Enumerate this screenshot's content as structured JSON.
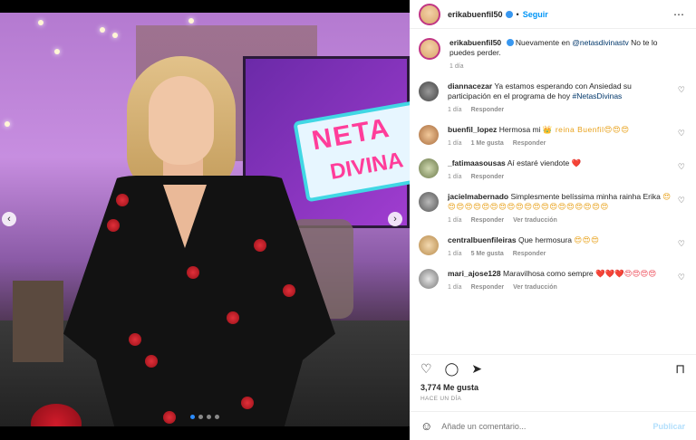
{
  "header": {
    "username": "erikabuenfil50",
    "follow_label": "Seguir",
    "separator": "•",
    "more_icon": "⋯"
  },
  "caption": {
    "username": "erikabuenfil50",
    "text_pre": "Nuevamente en ",
    "mention": "@netasdivinastv",
    "text_post": " No te lo puedes perder.",
    "time": "1 día"
  },
  "comments": [
    {
      "username": "diannacezar",
      "text": "Ya estamos esperando con Ansiedad su participación en el programa de hoy ",
      "hashtag": "#NetasDivinas",
      "time": "1 día",
      "likes": "",
      "reply": "Responder",
      "translate": ""
    },
    {
      "username": "buenfil_lopez",
      "text": "Hermosa mi ",
      "emoji": "👑 reina Buenfil😍😍😍",
      "time": "1 día",
      "likes": "1 Me gusta",
      "reply": "Responder",
      "translate": ""
    },
    {
      "username": "_fatimaasousas",
      "text": "Aí estaré viendote ",
      "emoji": "❤️",
      "time": "1 día",
      "likes": "",
      "reply": "Responder",
      "translate": ""
    },
    {
      "username": "jacielmabernado",
      "text": "Simplesmente belíssima minha rainha Erika ",
      "emoji": "😍😍😍😍😍😍😍😍😍😍😍😍😍😍😍😍😍😍😍😍",
      "time": "1 día",
      "likes": "",
      "reply": "Responder",
      "translate": "Ver traducción"
    },
    {
      "username": "centralbuenfileiras",
      "text": "Que hermosura ",
      "emoji": "😍😍😍",
      "time": "1 día",
      "likes": "5 Me gusta",
      "reply": "Responder",
      "translate": ""
    },
    {
      "username": "mari_ajose128",
      "text": "Maravilhosa como sempre ",
      "emoji": "❤️❤️❤️😍😍😍😍",
      "time": "1 día",
      "likes": "",
      "reply": "Responder",
      "translate": "Ver traducción"
    }
  ],
  "actions": {
    "like_icon": "♡",
    "comment_icon": "◯",
    "share_icon": "➤",
    "save_icon": "⊓"
  },
  "likes_text": "3,774 Me gusta",
  "post_date": "HACE UN DÍA",
  "add_comment": {
    "placeholder": "Añade un comentario...",
    "post_label": "Publicar",
    "emoji_icon": "☺"
  },
  "media": {
    "prev_icon": "‹",
    "next_icon": "›",
    "sign_line1": "NETA",
    "sign_line2": "DIVINA"
  }
}
